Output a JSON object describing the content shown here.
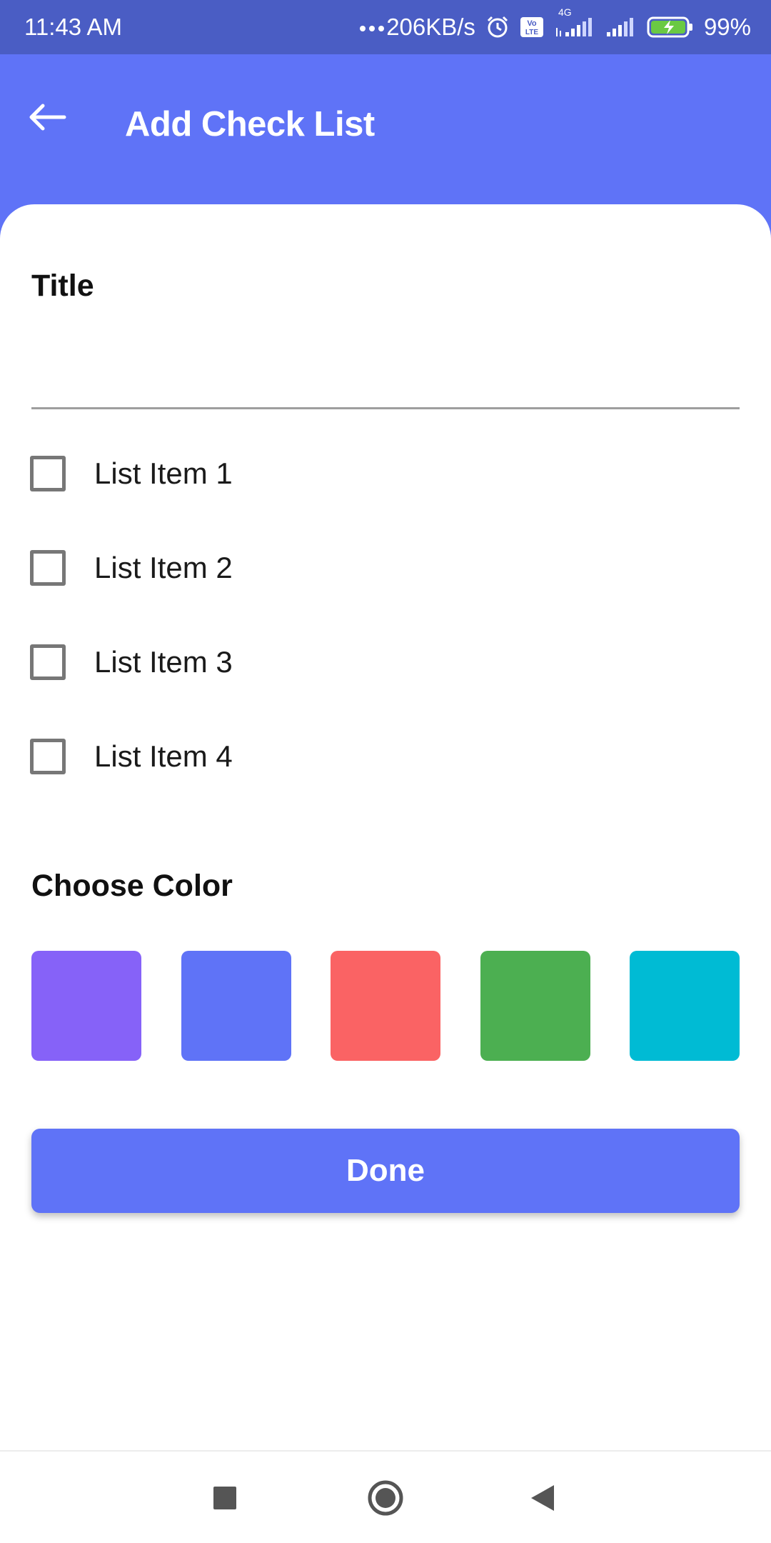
{
  "status_bar": {
    "time": "11:43 AM",
    "network_speed": "206KB/s",
    "battery_percent": "99%",
    "icons": [
      "dots-icon",
      "alarm-icon",
      "volte-icon",
      "signal-4g-icon",
      "signal-icon",
      "battery-charging-icon"
    ],
    "network_type": "4G"
  },
  "app_bar": {
    "title": "Add Check List",
    "back_icon": "back-arrow-icon"
  },
  "form": {
    "title_label": "Title",
    "title_value": "",
    "list_items": [
      {
        "label": "List Item 1",
        "checked": false
      },
      {
        "label": "List Item 2",
        "checked": false
      },
      {
        "label": "List Item 3",
        "checked": false
      },
      {
        "label": "List Item 4",
        "checked": false
      }
    ],
    "choose_color_label": "Choose Color",
    "colors": [
      "#8662f8",
      "#5f73f7",
      "#fa6364",
      "#4caf51",
      "#00bbd4"
    ],
    "done_label": "Done"
  },
  "theme": {
    "primary": "#5f73f7",
    "status_bar": "#4a5dc4"
  },
  "nav_bar": {
    "buttons": [
      "recents-square-icon",
      "home-circle-icon",
      "back-triangle-icon"
    ]
  }
}
